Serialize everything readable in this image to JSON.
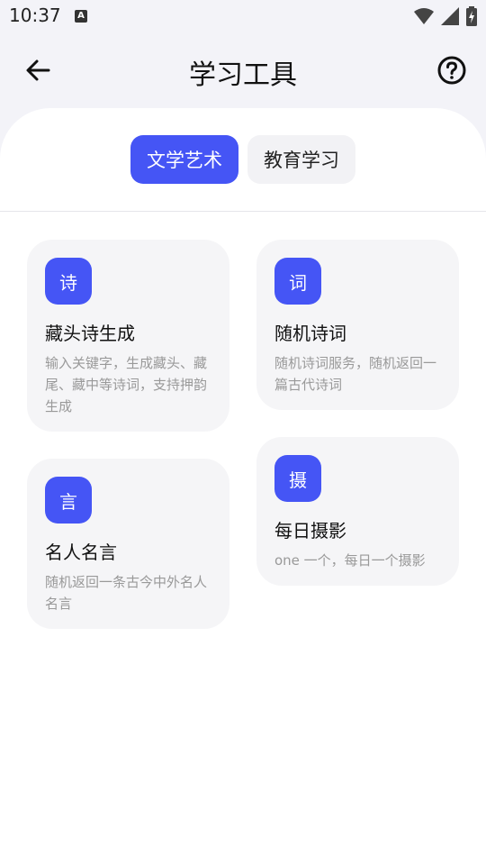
{
  "status": {
    "time": "10:37",
    "notif_icon_letter": "A"
  },
  "header": {
    "title": "学习工具"
  },
  "tabs": [
    {
      "label": "文学艺术",
      "active": true
    },
    {
      "label": "教育学习",
      "active": false
    }
  ],
  "cards": [
    {
      "icon_char": "诗",
      "title": "藏头诗生成",
      "desc": "输入关键字，生成藏头、藏尾、藏中等诗词，支持押韵生成"
    },
    {
      "icon_char": "词",
      "title": "随机诗词",
      "desc": "随机诗词服务，随机返回一篇古代诗词"
    },
    {
      "icon_char": "言",
      "title": "名人名言",
      "desc": "随机返回一条古今中外名人名言"
    },
    {
      "icon_char": "摄",
      "title": "每日摄影",
      "desc": "one 一个，每日一个摄影"
    }
  ],
  "colors": {
    "accent": "#4555f5",
    "background": "#f3f3f8",
    "card": "#f5f5f7"
  }
}
